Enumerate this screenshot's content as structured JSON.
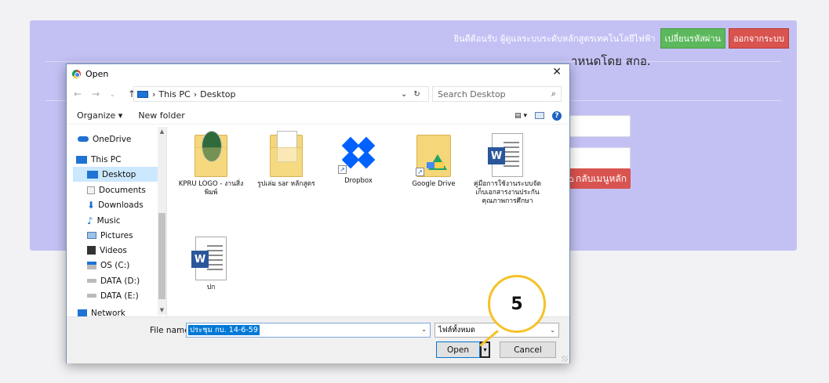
{
  "webpage": {
    "welcome_text": "ยินดีต้อนรับ",
    "user_name": "ผู้ดูแลระบบระดับหลักสูตรเทคโนโลยีไฟฟ้า",
    "change_password_label": "เปลี่ยนรหัสผ่าน",
    "logout_label": "ออกจากระบบ",
    "subtitle_fragment": "าหนดโดย สกอ.",
    "back_button_label": "กลับเมนูหลัก"
  },
  "dialog": {
    "title": "Open",
    "breadcrumb": [
      "This PC",
      "Desktop"
    ],
    "search_placeholder": "Search Desktop",
    "toolbar": {
      "organize_label": "Organize ▾",
      "new_folder_label": "New folder"
    },
    "nav_items": [
      {
        "label": "OneDrive"
      },
      {
        "label": "This PC"
      },
      {
        "label": "Desktop",
        "selected": true
      },
      {
        "label": "Documents"
      },
      {
        "label": "Downloads"
      },
      {
        "label": "Music"
      },
      {
        "label": "Pictures"
      },
      {
        "label": "Videos"
      },
      {
        "label": "OS (C:)"
      },
      {
        "label": "DATA (D:)"
      },
      {
        "label": "DATA (E:)"
      },
      {
        "label": "Network"
      }
    ],
    "files": [
      {
        "name": "KPRU LOGO - งานสิ่งพิมพ์",
        "type": "folder"
      },
      {
        "name": "รูปเล่ม sar หลักสูตร",
        "type": "folder"
      },
      {
        "name": "Dropbox",
        "type": "dropbox-shortcut"
      },
      {
        "name": "Google Drive",
        "type": "gdrive-shortcut"
      },
      {
        "name": "คู่มือการใช้งานระบบจัดเก็บเอกสารงานประกันคุณภาพการศึกษา",
        "type": "word"
      },
      {
        "name": "ปก",
        "type": "word"
      }
    ],
    "file_name_label": "File name:",
    "file_name_value": "ประชุม กบ. 14-6-59",
    "file_type_value": "ไฟล์ทั้งหมด",
    "open_label": "Open",
    "cancel_label": "Cancel"
  },
  "annotation": {
    "step_number": "5"
  }
}
